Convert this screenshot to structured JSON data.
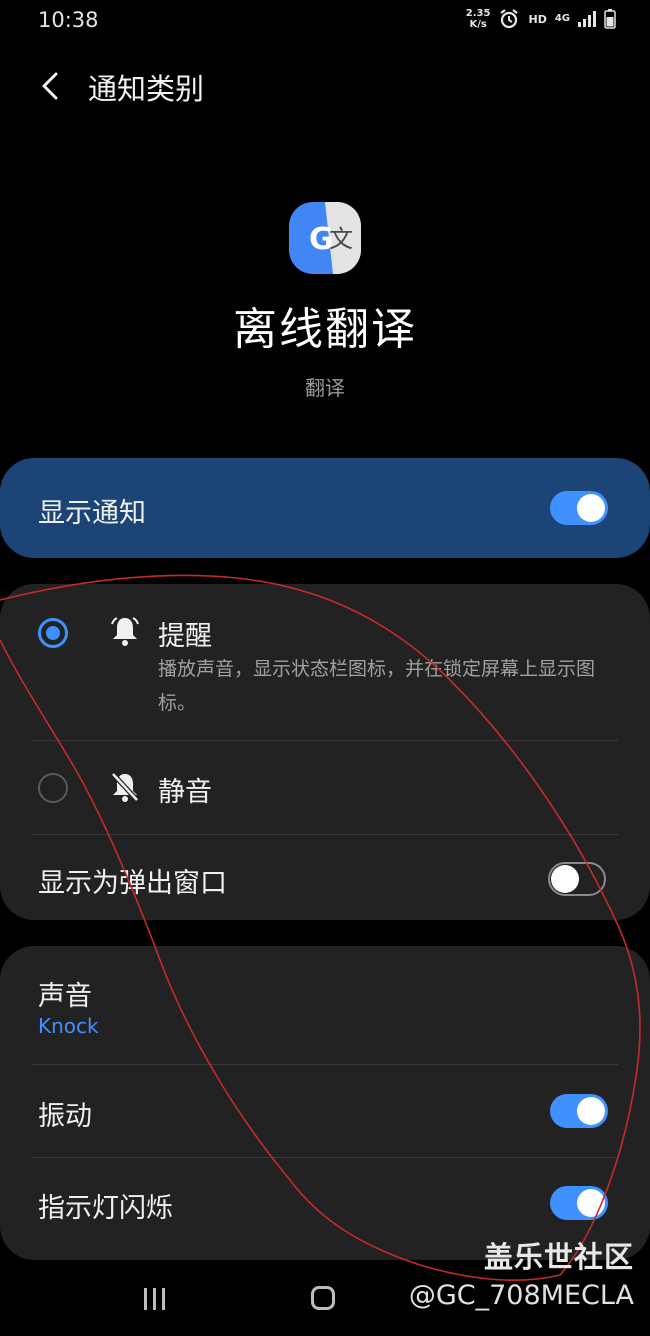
{
  "status_bar": {
    "time": "10:38",
    "net_speed_value": "2.35",
    "net_speed_unit": "K/s",
    "hd": "HD",
    "network": "4G",
    "icons": [
      "alarm-icon",
      "signal-icon",
      "battery-icon"
    ]
  },
  "header": {
    "title": "通知类别"
  },
  "app": {
    "name": "离线翻译",
    "category": "翻译",
    "icon_letter_a": "G",
    "icon_letter_b": "文"
  },
  "show_notifications": {
    "label": "显示通知",
    "enabled": true
  },
  "alert_section": {
    "options": [
      {
        "label": "提醒",
        "description": "播放声音，显示状态栏图标，并在锁定屏幕上显示图标。",
        "selected": true,
        "icon": "bell-icon"
      },
      {
        "label": "静音",
        "selected": false,
        "icon": "bell-off-icon"
      }
    ],
    "popup": {
      "label": "显示为弹出窗口",
      "enabled": false
    }
  },
  "sound_section": {
    "sound": {
      "label": "声音",
      "value": "Knock"
    },
    "vibration": {
      "label": "振动",
      "enabled": true
    },
    "led": {
      "label": "指示灯闪烁",
      "enabled": true
    }
  },
  "watermark": {
    "site": "盖乐世社区",
    "user": "@GC_708MECLA"
  },
  "colors": {
    "accent": "#3e91ff",
    "highlight_card": "#1c4476",
    "card": "#222222",
    "scribble": "#c42b2b"
  }
}
